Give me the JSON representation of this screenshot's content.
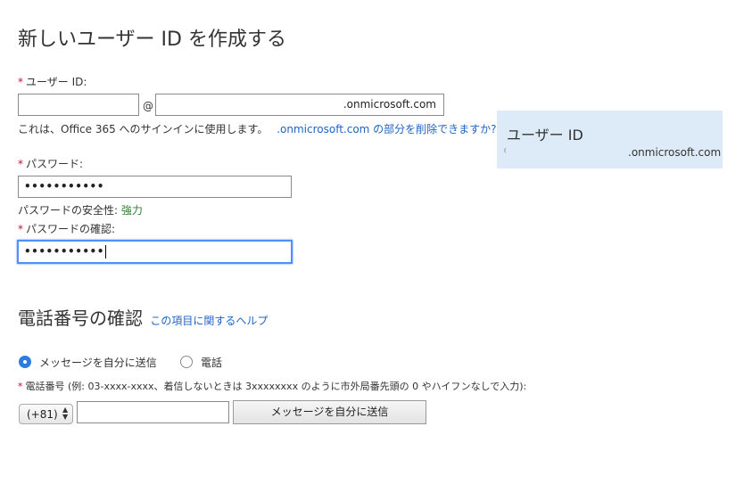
{
  "page_title": "新しいユーザー ID を作成する",
  "user_id": {
    "required_mark": "*",
    "label": "ユーザー ID:",
    "username_value": "",
    "at_sign": "@",
    "domain_value": ".onmicrosoft.com",
    "help_text": "これは、Office 365 へのサインインに使用します。",
    "help_link": ".onmicrosoft.com の部分を削除できますか?"
  },
  "password": {
    "required_mark": "*",
    "label": "パスワード:",
    "masked_value": "•••••••••••",
    "strength_label": "パスワードの安全性:",
    "strength_value": "強力"
  },
  "confirm_password": {
    "required_mark": "*",
    "label": "パスワードの確認:",
    "masked_value": "•••••••••••"
  },
  "info_panel": {
    "title": "ユーザー ID",
    "prefix": "(",
    "domain": ".onmicrosoft.com"
  },
  "phone_verification": {
    "title": "電話番号の確認",
    "help_link": "この項目に関するヘルプ",
    "options": [
      {
        "label": "メッセージを自分に送信",
        "selected": true
      },
      {
        "label": "電話",
        "selected": false
      }
    ],
    "required_mark": "*",
    "phone_label": "電話番号 (例: 03-xxxx-xxxx、着信しないときは 3xxxxxxxx のように市外局番先頭の 0 やハイフンなしで入力):",
    "country_code": "(+81)",
    "phone_value": "",
    "send_button": "メッセージを自分に送信"
  },
  "colors": {
    "link": "#1e63c6",
    "required": "#c8102e",
    "strength": "#2e7d32",
    "panel_bg": "#dcebf7",
    "focus": "#4d90fe"
  }
}
